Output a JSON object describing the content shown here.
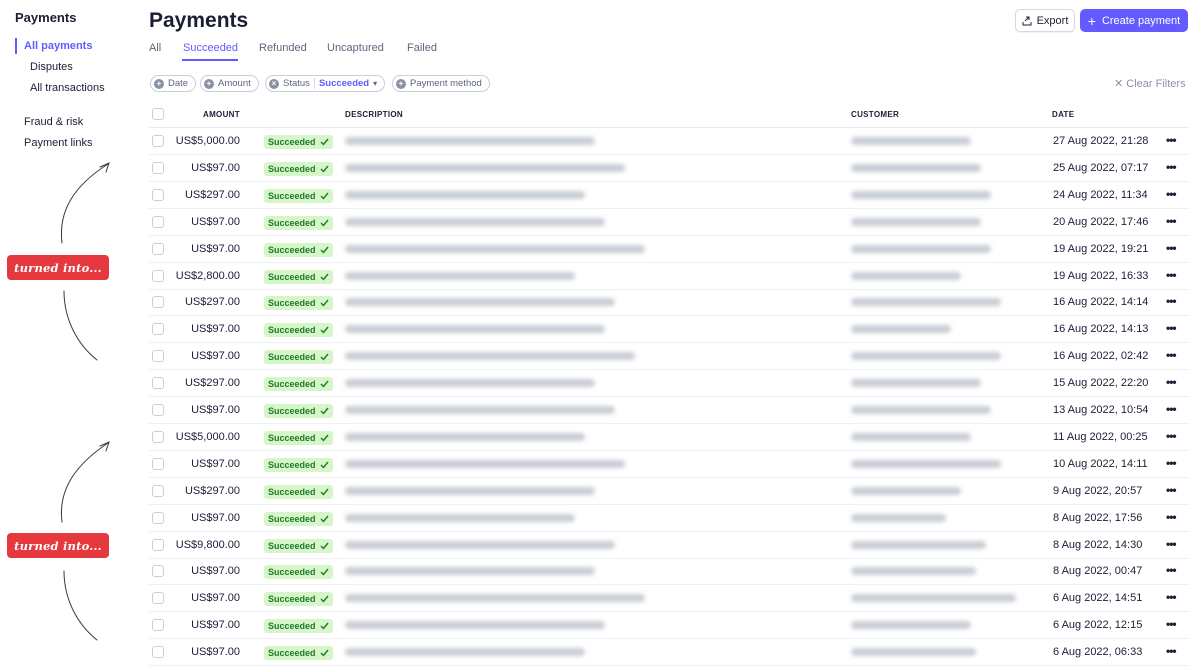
{
  "sidebar": {
    "title": "Payments",
    "items": [
      "All payments",
      "Disputes",
      "All transactions",
      "Fraud & risk",
      "Payment links"
    ]
  },
  "annotations": [
    "turned into...",
    "turned into..."
  ],
  "header": {
    "title": "Payments",
    "export_label": "Export",
    "create_label": "Create payment",
    "accent_color": "#635bff"
  },
  "tabs": [
    "All",
    "Succeeded",
    "Refunded",
    "Uncaptured",
    "Failed"
  ],
  "active_tab": "Succeeded",
  "filters": {
    "date": "Date",
    "amount": "Amount",
    "status_label": "Status",
    "status_value": "Succeeded",
    "method": "Payment method",
    "clear": "Clear Filters"
  },
  "table": {
    "columns": [
      "AMOUNT",
      "DESCRIPTION",
      "CUSTOMER",
      "DATE"
    ],
    "status_label": "Succeeded",
    "rows": [
      {
        "amount": "US$5,000.00",
        "date": "27 Aug 2022, 21:28"
      },
      {
        "amount": "US$97.00",
        "date": "25 Aug 2022, 07:17"
      },
      {
        "amount": "US$297.00",
        "date": "24 Aug 2022, 11:34"
      },
      {
        "amount": "US$97.00",
        "date": "20 Aug 2022, 17:46"
      },
      {
        "amount": "US$97.00",
        "date": "19 Aug 2022, 19:21"
      },
      {
        "amount": "US$2,800.00",
        "date": "19 Aug 2022, 16:33"
      },
      {
        "amount": "US$297.00",
        "date": "16 Aug 2022, 14:14"
      },
      {
        "amount": "US$97.00",
        "date": "16 Aug 2022, 14:13"
      },
      {
        "amount": "US$97.00",
        "date": "16 Aug 2022, 02:42"
      },
      {
        "amount": "US$297.00",
        "date": "15 Aug 2022, 22:20"
      },
      {
        "amount": "US$97.00",
        "date": "13 Aug 2022, 10:54"
      },
      {
        "amount": "US$5,000.00",
        "date": "11 Aug 2022, 00:25"
      },
      {
        "amount": "US$97.00",
        "date": "10 Aug 2022, 14:11"
      },
      {
        "amount": "US$297.00",
        "date": "9 Aug 2022, 20:57"
      },
      {
        "amount": "US$97.00",
        "date": "8 Aug 2022, 17:56"
      },
      {
        "amount": "US$9,800.00",
        "date": "8 Aug 2022, 14:30"
      },
      {
        "amount": "US$97.00",
        "date": "8 Aug 2022, 00:47"
      },
      {
        "amount": "US$97.00",
        "date": "6 Aug 2022, 14:51"
      },
      {
        "amount": "US$97.00",
        "date": "6 Aug 2022, 12:15"
      },
      {
        "amount": "US$97.00",
        "date": "6 Aug 2022, 06:33"
      }
    ]
  }
}
